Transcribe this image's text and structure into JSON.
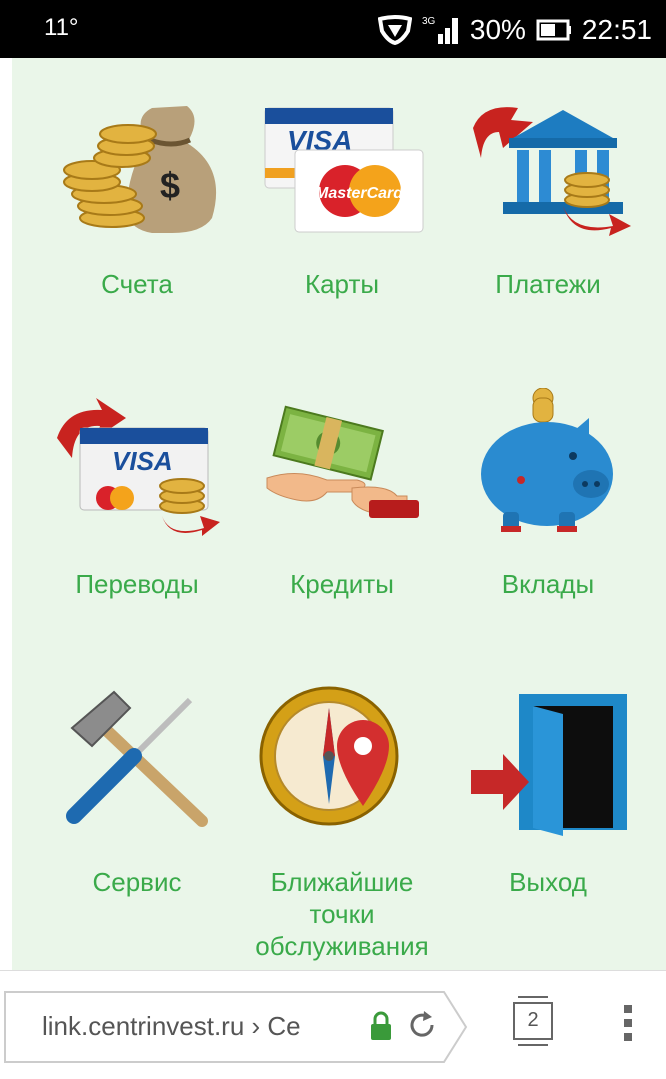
{
  "status_bar": {
    "temperature": "11°",
    "network": "3G",
    "battery": "30%",
    "time": "22:51"
  },
  "tiles": [
    {
      "label": "Счета",
      "icon": "money-bag-coins-icon"
    },
    {
      "label": "Карты",
      "icon": "credit-cards-icon"
    },
    {
      "label": "Платежи",
      "icon": "bank-payment-icon"
    },
    {
      "label": "Переводы",
      "icon": "card-transfer-icon"
    },
    {
      "label": "Кредиты",
      "icon": "hand-money-icon"
    },
    {
      "label": "Вклады",
      "icon": "piggy-bank-icon"
    },
    {
      "label": "Сервис",
      "icon": "tools-icon"
    },
    {
      "label": "Ближайшие точки обслуживания",
      "icon": "compass-location-icon"
    },
    {
      "label": "Выход",
      "icon": "exit-door-icon"
    }
  ],
  "card_brands": {
    "visa": "VISA",
    "mastercard": "MasterCard"
  },
  "browser": {
    "url": "link.centrinvest.ru › Ce",
    "tab_count": "2"
  },
  "colors": {
    "background": "#eaf6e9",
    "label": "#3aaa4a",
    "lock": "#3a9a3a"
  }
}
